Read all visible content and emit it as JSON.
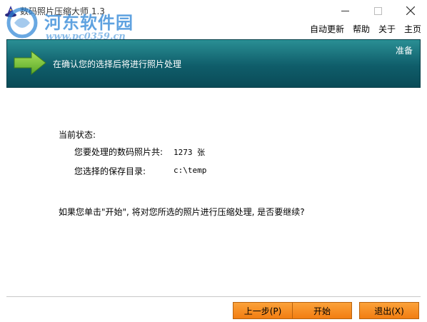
{
  "window": {
    "title": "数码照片压缩大师 1.3",
    "controls": {
      "minimize": "—",
      "maximize": "☐",
      "close": "✕"
    }
  },
  "watermark": {
    "line1": "河东软件园",
    "line2": "www.pc0359.cn"
  },
  "menu": {
    "items": [
      "自动更新",
      "帮助",
      "关于",
      "主页"
    ]
  },
  "banner": {
    "text": "在确认您的选择后将进行照片处理",
    "status": "准备",
    "arrow_icon": "right-arrow-icon"
  },
  "content": {
    "status_label": "当前状态:",
    "photo_count_label": "您要处理的数码照片共:",
    "photo_count_value": "1273 张",
    "save_dir_label": "您选择的保存目录:",
    "save_dir_value": "c:\\temp",
    "confirm_text": "如果您单击\"开始\", 将对您所选的照片进行压缩处理, 是否要继续?"
  },
  "buttons": {
    "prev": "上一步(P)",
    "start": "开始",
    "exit": "退出(X)"
  },
  "colors": {
    "banner_top": "#2a8f94",
    "banner_bottom": "#0a4b57",
    "arrow_green": "#7bc83a",
    "button_orange": "#f27d12",
    "watermark_blue": "#2a84d6"
  }
}
